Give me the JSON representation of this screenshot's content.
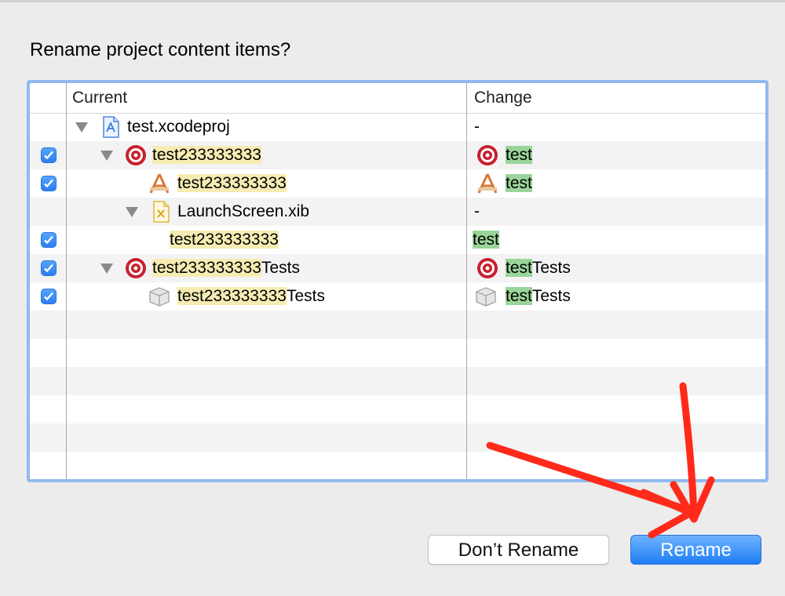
{
  "dialog": {
    "title": "Rename project content items?",
    "columns": {
      "current": "Current",
      "change": "Change"
    },
    "rows": [
      {
        "current": "test.xcodeproj",
        "change_prefix": "-",
        "change_suffix": "",
        "icon": "xcodeproj-icon",
        "checked": false
      },
      {
        "current": "test233333333",
        "current_suffix": "",
        "change_prefix": "test",
        "change_suffix": "",
        "icon": "target-icon",
        "checked": true
      },
      {
        "current": "test233333333",
        "current_suffix": "",
        "change_prefix": "test",
        "change_suffix": "",
        "icon": "app-icon",
        "checked": true
      },
      {
        "current": "LaunchScreen.xib",
        "change_prefix": "-",
        "change_suffix": "",
        "icon": "xib-icon",
        "checked": false
      },
      {
        "current": "test233333333",
        "current_suffix": "",
        "change_prefix": "test",
        "change_suffix": "",
        "icon": "none",
        "checked": true
      },
      {
        "current": "test233333333",
        "current_suffix": "Tests",
        "change_prefix": "test",
        "change_suffix": "Tests",
        "icon": "target-icon",
        "checked": true
      },
      {
        "current": "test233333333",
        "current_suffix": "Tests",
        "change_prefix": "test",
        "change_suffix": "Tests",
        "icon": "bundle-icon",
        "checked": true
      }
    ],
    "buttons": {
      "dont_rename": "Don’t Rename",
      "rename": "Rename"
    }
  },
  "colors": {
    "accent": "#2b7ff0",
    "highlight_old": "#f6ecb3",
    "highlight_new": "#9ad49a",
    "annotation_arrow": "#ff2a1a"
  }
}
